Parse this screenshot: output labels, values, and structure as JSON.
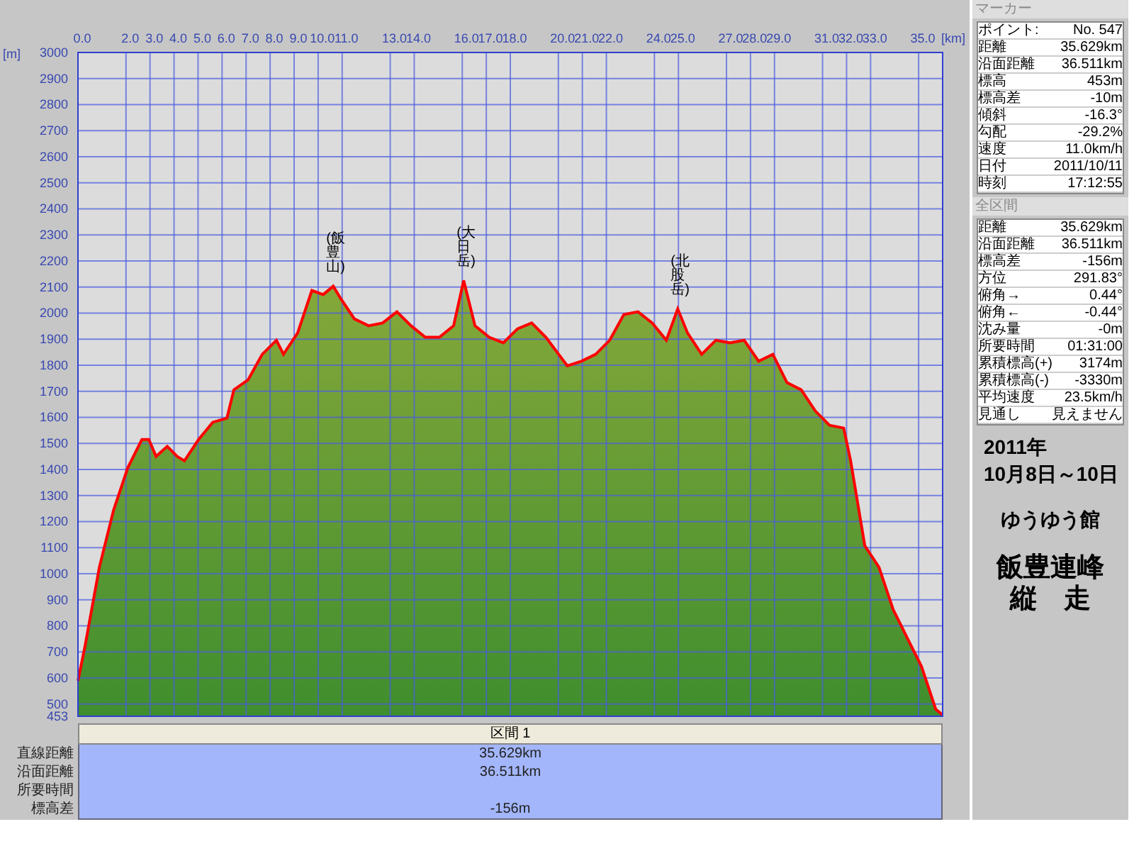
{
  "chart": {
    "y_unit": "[m]",
    "x_unit": "[km]",
    "chart_data": {
      "type": "area",
      "x": [
        0,
        0.3,
        0.89,
        1.48,
        2.07,
        2.66,
        2.95,
        3.25,
        3.72,
        4.13,
        4.43,
        5.02,
        5.61,
        6.2,
        6.49,
        7.08,
        7.67,
        8.26,
        8.56,
        9.15,
        9.74,
        10.21,
        10.63,
        10.92,
        11.51,
        12.1,
        12.69,
        13.28,
        13.87,
        14.46,
        15.05,
        15.64,
        16.06,
        16.53,
        17.12,
        17.71,
        18.3,
        18.89,
        19.48,
        20.37,
        20.96,
        21.55,
        22.14,
        22.73,
        23.32,
        23.91,
        24.5,
        24.97,
        25.38,
        25.97,
        26.56,
        27.15,
        27.74,
        28.34,
        28.93,
        29.52,
        30.11,
        30.7,
        31.29,
        31.88,
        32.17,
        32.76,
        33.35,
        33.94,
        34.53,
        35.12,
        35.71,
        36.0
      ],
      "grid": true,
      "series": [
        {
          "color": "#ff0000",
          "values": [
            589,
            725,
            1025,
            1243,
            1406,
            1515,
            1515,
            1450,
            1488,
            1450,
            1433,
            1515,
            1581,
            1597,
            1706,
            1744,
            1842,
            1896,
            1842,
            1924,
            2087,
            2071,
            2103,
            2059,
            1978,
            1951,
            1962,
            2005,
            1951,
            1907,
            1907,
            1951,
            2125,
            1951,
            1907,
            1886,
            1940,
            1962,
            1907,
            1798,
            1815,
            1842,
            1896,
            1994,
            2005,
            1962,
            1896,
            2016,
            1924,
            1842,
            1896,
            1886,
            1896,
            1815,
            1842,
            1733,
            1706,
            1624,
            1570,
            1559,
            1433,
            1107,
            1025,
            862,
            753,
            644,
            480,
            458
          ]
        }
      ],
      "xlim": [
        0,
        36
      ],
      "ylim": [
        453,
        3000
      ],
      "xticks": [
        {
          "value": 0,
          "label": "0.0"
        },
        {
          "value": 2,
          "label": "2.0"
        },
        {
          "value": 3,
          "label": "3.0"
        },
        {
          "value": 4,
          "label": "4.0"
        },
        {
          "value": 5,
          "label": "5.0"
        },
        {
          "value": 6,
          "label": "6.0"
        },
        {
          "value": 7,
          "label": "7.0"
        },
        {
          "value": 8,
          "label": "8.0"
        },
        {
          "value": 9,
          "label": "9.0"
        },
        {
          "value": 10,
          "label": "10.0"
        },
        {
          "value": 11,
          "label": "11.0"
        },
        {
          "value": 13,
          "label": "13.0"
        },
        {
          "value": 14,
          "label": "14.0"
        },
        {
          "value": 16,
          "label": "16.0"
        },
        {
          "value": 17,
          "label": "17.0"
        },
        {
          "value": 18,
          "label": "18.0"
        },
        {
          "value": 20,
          "label": "20.0"
        },
        {
          "value": 21,
          "label": "21.0"
        },
        {
          "value": 22,
          "label": "22.0"
        },
        {
          "value": 24,
          "label": "24.0"
        },
        {
          "value": 25,
          "label": "25.0"
        },
        {
          "value": 27,
          "label": "27.0"
        },
        {
          "value": 28,
          "label": "28.0"
        },
        {
          "value": 29,
          "label": "29.0"
        },
        {
          "value": 31,
          "label": "31.0"
        },
        {
          "value": 32,
          "label": "32.0"
        },
        {
          "value": 33,
          "label": "33.0"
        },
        {
          "value": 35,
          "label": "35.0"
        }
      ],
      "yticks": [
        453,
        500,
        600,
        700,
        800,
        900,
        1000,
        1100,
        1200,
        1300,
        1400,
        1500,
        1600,
        1700,
        1800,
        1900,
        2000,
        2100,
        2200,
        2300,
        2400,
        2500,
        2600,
        2700,
        2800,
        2900,
        3000
      ],
      "annotations": [
        {
          "x": 10.63,
          "y": 2103,
          "text": "(飯豊山)"
        },
        {
          "x": 16.06,
          "y": 2125,
          "text": "(大日岳)"
        },
        {
          "x": 24.97,
          "y": 2016,
          "text": "(北股岳)"
        }
      ]
    }
  },
  "section_header": "区間 1",
  "section_rows": [
    {
      "label": "直線距離",
      "value": "35.629km"
    },
    {
      "label": "沿面距離",
      "value": "36.511km"
    },
    {
      "label": "所要時間"
    },
    {
      "label": "標高差",
      "value": "-156m"
    }
  ],
  "marker": {
    "title": "マーカー",
    "rows": [
      {
        "label": "ポイント:",
        "value": "No. 547"
      },
      {
        "label": "距離",
        "value": "35.629km"
      },
      {
        "label": "沿面距離",
        "value": "36.511km"
      },
      {
        "label": "標高",
        "value": "453m"
      },
      {
        "label": "標高差",
        "value": "-10m"
      },
      {
        "label": "傾斜",
        "value": "-16.3°"
      },
      {
        "label": "勾配",
        "value": "-29.2%"
      },
      {
        "label": "速度",
        "value": "11.0km/h"
      },
      {
        "label": "日付",
        "value": "2011/10/11"
      },
      {
        "label": "時刻",
        "value": "17:12:55"
      }
    ]
  },
  "total": {
    "title": "全区間",
    "rows": [
      {
        "label": "距離",
        "value": "35.629km"
      },
      {
        "label": "沿面距離",
        "value": "36.511km"
      },
      {
        "label": "標高差",
        "value": "-156m"
      },
      {
        "label": "方位",
        "value": "291.83°"
      },
      {
        "label": "俯角→",
        "value": "0.44°"
      },
      {
        "label": "俯角←",
        "value": "-0.44°"
      },
      {
        "label": "沈み量",
        "value": "-0m"
      },
      {
        "label": "所要時間",
        "value": "01:31:00"
      },
      {
        "label": "累積標高(+)",
        "value": "3174m"
      },
      {
        "label": "累積標高(-)",
        "value": "-3330m"
      },
      {
        "label": "平均速度",
        "value": "23.5km/h"
      },
      {
        "label": "見通し",
        "value": "見えません"
      }
    ]
  },
  "notes": [
    {
      "kind": "date",
      "text": "2011年"
    },
    {
      "kind": "date",
      "text": "10月8日～10日"
    },
    {
      "kind": "org",
      "text": "ゆうゆう館"
    },
    {
      "kind": "title",
      "text": "飯豊連峰"
    },
    {
      "kind": "title",
      "text": "縦　走"
    }
  ]
}
